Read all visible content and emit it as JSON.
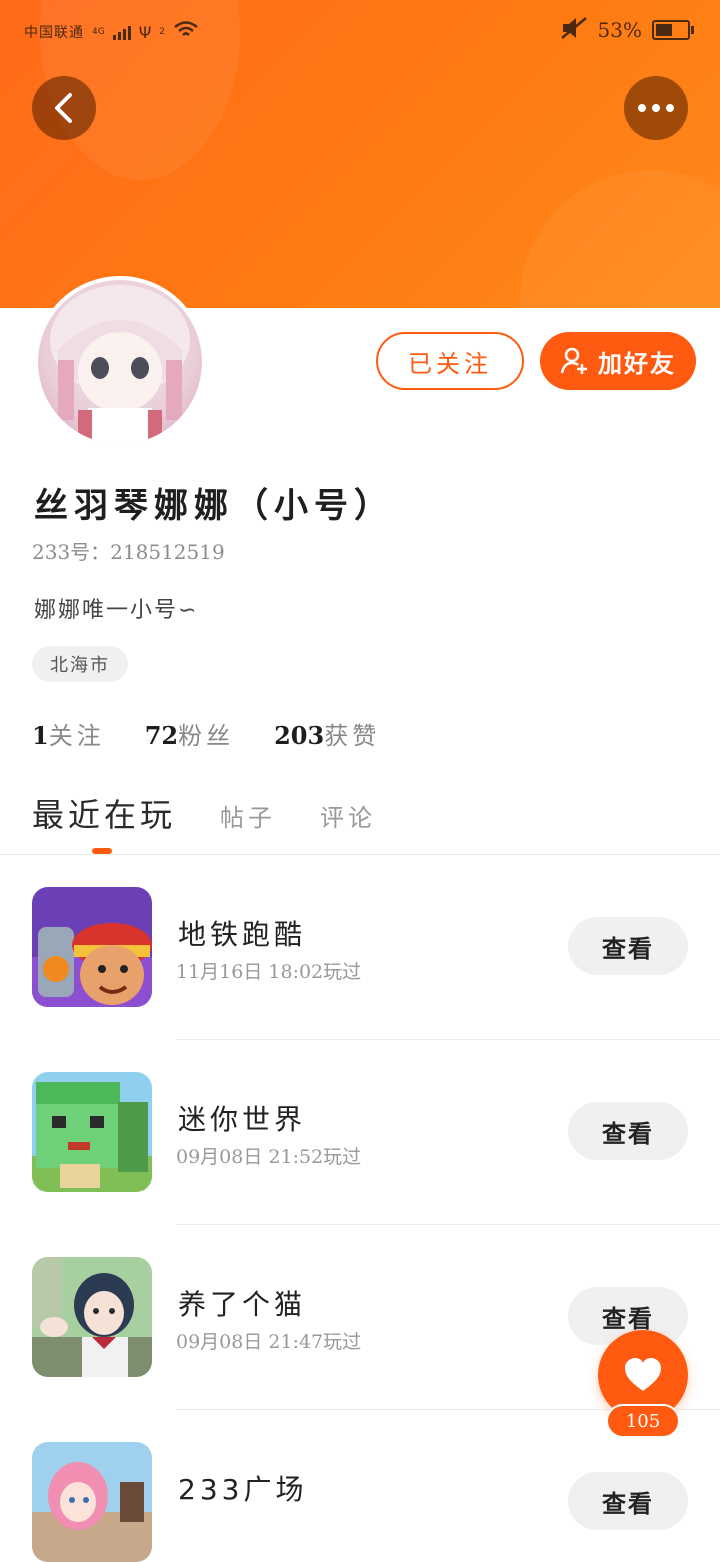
{
  "status_bar": {
    "carrier": "中国联通",
    "network": "4G",
    "sim2": "2",
    "battery_percent": "53%"
  },
  "header": {
    "back_icon": "chevron-left-icon",
    "more_icon": "more-horizontal-icon",
    "background_color": "#ff7a12"
  },
  "profile": {
    "follow_label": "已关注",
    "add_friend_label": "加好友",
    "username": "丝羽琴娜娜（小号）",
    "uid": "233号：218512519",
    "bio": "娜娜唯一小号∽",
    "location": "北海市",
    "stats": [
      {
        "num": "1",
        "label": "关注"
      },
      {
        "num": "72",
        "label": "粉丝"
      },
      {
        "num": "203",
        "label": "获赞"
      }
    ]
  },
  "tabs": [
    {
      "label": "最近在玩",
      "active": true
    },
    {
      "label": "帖子",
      "active": false
    },
    {
      "label": "评论",
      "active": false
    }
  ],
  "games": [
    {
      "name": "地铁跑酷",
      "time": "11月16日  18:02玩过",
      "action": "查看"
    },
    {
      "name": "迷你世界",
      "time": "09月08日  21:52玩过",
      "action": "查看"
    },
    {
      "name": "养了个猫",
      "time": "09月08日  21:47玩过",
      "action": "查看"
    },
    {
      "name": "233广场",
      "time": "",
      "action": "查看"
    }
  ],
  "like_fab": {
    "icon": "heart-icon",
    "count": "105"
  },
  "colors": {
    "accent": "#ff5a10",
    "muted_text": "#999999"
  }
}
